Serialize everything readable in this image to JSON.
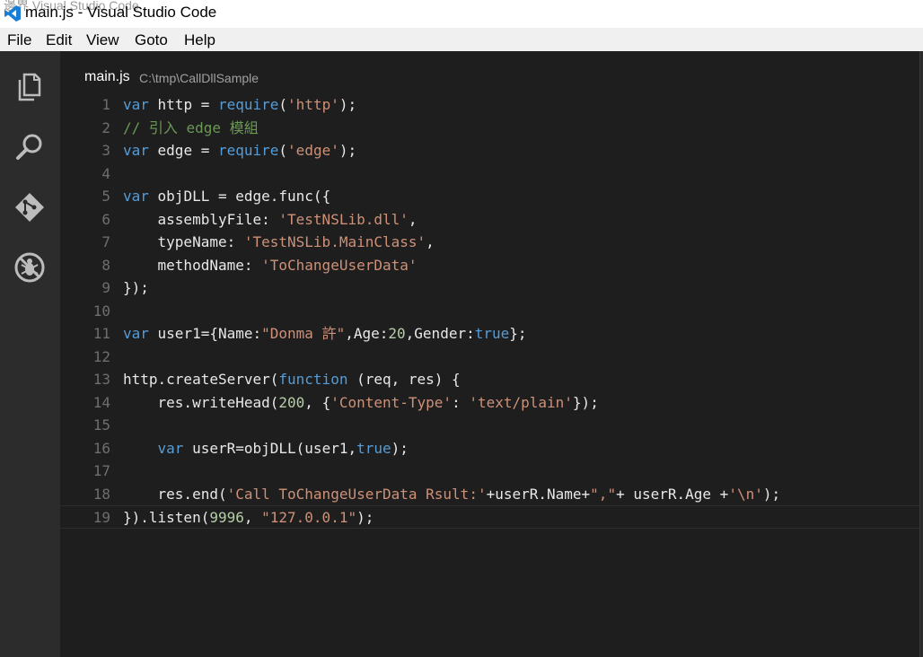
{
  "window": {
    "ghost_title": "邊界 Visual Studio Code",
    "title": "main.js - Visual Studio Code"
  },
  "menu": [
    "File",
    "Edit",
    "View",
    "Goto",
    "Help"
  ],
  "activity_bar": [
    "files-icon",
    "search-icon",
    "git-icon",
    "debug-icon"
  ],
  "editor": {
    "file_name": "main.js",
    "file_path": "C:\\tmp\\CallDllSample",
    "current_line": 19,
    "lines": [
      [
        [
          "k",
          "var"
        ],
        [
          "p",
          " http = "
        ],
        [
          "k",
          "require"
        ],
        [
          "p",
          "("
        ],
        [
          "s",
          "'http'"
        ],
        [
          "p",
          ");"
        ]
      ],
      [
        [
          "c",
          "// 引入 edge 模組"
        ]
      ],
      [
        [
          "k",
          "var"
        ],
        [
          "p",
          " edge = "
        ],
        [
          "k",
          "require"
        ],
        [
          "p",
          "("
        ],
        [
          "s",
          "'edge'"
        ],
        [
          "p",
          ");"
        ]
      ],
      [],
      [
        [
          "k",
          "var"
        ],
        [
          "p",
          " objDLL = edge.func({"
        ]
      ],
      [
        [
          "p",
          "    assemblyFile: "
        ],
        [
          "s",
          "'TestNSLib.dll'"
        ],
        [
          "p",
          ","
        ]
      ],
      [
        [
          "p",
          "    typeName: "
        ],
        [
          "s",
          "'TestNSLib.MainClass'"
        ],
        [
          "p",
          ","
        ]
      ],
      [
        [
          "p",
          "    methodName: "
        ],
        [
          "s",
          "'ToChangeUserData'"
        ]
      ],
      [
        [
          "p",
          "});"
        ]
      ],
      [],
      [
        [
          "k",
          "var"
        ],
        [
          "p",
          " user1={Name:"
        ],
        [
          "s",
          "\"Donma 許\""
        ],
        [
          "p",
          ",Age:"
        ],
        [
          "n",
          "20"
        ],
        [
          "p",
          ",Gender:"
        ],
        [
          "k",
          "true"
        ],
        [
          "p",
          "};"
        ]
      ],
      [],
      [
        [
          "p",
          "http.createServer("
        ],
        [
          "k",
          "function"
        ],
        [
          "p",
          " (req, res) {"
        ]
      ],
      [
        [
          "p",
          "    res.writeHead("
        ],
        [
          "n",
          "200"
        ],
        [
          "p",
          ", {"
        ],
        [
          "s",
          "'Content-Type'"
        ],
        [
          "p",
          ": "
        ],
        [
          "s",
          "'text/plain'"
        ],
        [
          "p",
          "});"
        ]
      ],
      [],
      [
        [
          "p",
          "    "
        ],
        [
          "k",
          "var"
        ],
        [
          "p",
          " userR=objDLL(user1,"
        ],
        [
          "k",
          "true"
        ],
        [
          "p",
          ");"
        ]
      ],
      [],
      [
        [
          "p",
          "    res.end("
        ],
        [
          "s",
          "'Call ToChangeUserData Rsult:'"
        ],
        [
          "p",
          "+userR.Name+"
        ],
        [
          "s",
          "\",\""
        ],
        [
          "p",
          "+ userR.Age +"
        ],
        [
          "s",
          "'\\n'"
        ],
        [
          "p",
          ");"
        ]
      ],
      [
        [
          "p",
          "}).listen("
        ],
        [
          "n",
          "9996"
        ],
        [
          "p",
          ", "
        ],
        [
          "s",
          "\"127.0.0.1\""
        ],
        [
          "p",
          ");"
        ]
      ]
    ]
  },
  "colors": {
    "keyword": "#569cd6",
    "string": "#ce9178",
    "number": "#b5cea8",
    "comment": "#6a9955",
    "text": "#e8e8e8",
    "line_number": "#6e6e6e"
  }
}
